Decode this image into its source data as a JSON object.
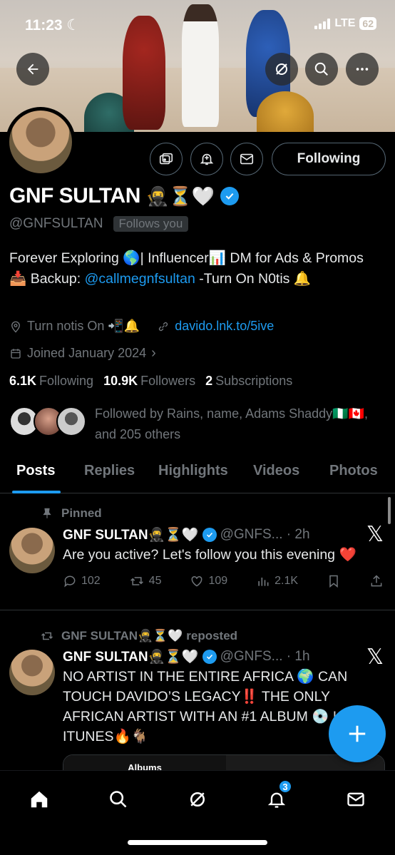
{
  "status_bar": {
    "time": "11:23",
    "network": "LTE",
    "battery": "62"
  },
  "profile": {
    "display_name": "GNF SULTAN",
    "name_emoji": "🥷⏳🤍",
    "handle": "@GNFSULTAN",
    "follows_you": "Follows you",
    "following_button": "Following",
    "bio_text": "Forever Exploring 🌎| Influencer📊 DM for Ads & Promos 📥 Backup: ",
    "bio_link": "@callmegnfsultan",
    "bio_tail": " -Turn On N0tis 🔔",
    "location": "Turn notis On 📲🔔",
    "website": "davido.lnk.to/5ive",
    "joined": "Joined January 2024",
    "following_count": "6.1K",
    "following_label": "Following",
    "followers_count": "10.9K",
    "followers_label": "Followers",
    "subscriptions_count": "2",
    "subscriptions_label": "Subscriptions",
    "followed_by": "Followed by Rains, name, Adams Shaddy🇳🇬🇨🇦, and 205 others"
  },
  "tabs": [
    "Posts",
    "Replies",
    "Highlights",
    "Videos",
    "Photos"
  ],
  "posts": [
    {
      "label": "Pinned",
      "name": "GNF SULTAN🥷⏳🤍",
      "handle_time": "@GNFS... · 2h",
      "text": "Are you active? Let's follow you this evening ❤️",
      "replies": "102",
      "reposts": "45",
      "likes": "109",
      "views": "2.1K"
    },
    {
      "label": "GNF SULTAN🥷⏳🤍 reposted",
      "name": "GNF SULTAN🥷⏳🤍",
      "handle_time": "@GNFS... · 1h",
      "text": "NO ARTIST IN THE ENTIRE AFRICA 🌍 CAN TOUCH DAVIDO’S LEGACY‼️ THE ONLY AFRICAN ARTIST WITH AN #1 ALBUM 💿 US 🇺🇸 ITUNES🔥🐐",
      "card_label": "Albums"
    }
  ],
  "nav": {
    "notifications_badge": "3"
  },
  "colors": {
    "accent": "#1d9bf0",
    "muted": "#71767b",
    "border": "#2f3336"
  }
}
